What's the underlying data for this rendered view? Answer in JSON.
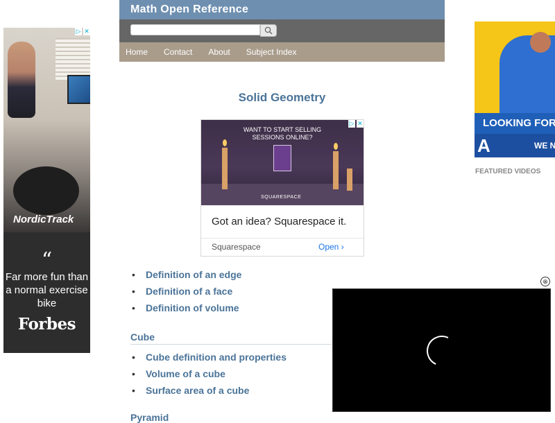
{
  "header": {
    "site_title": "Math Open Reference",
    "search_placeholder": "",
    "search_icon": "search-icon",
    "nav": [
      "Home",
      "Contact",
      "About",
      "Subject Index"
    ]
  },
  "main": {
    "title": "Solid Geometry",
    "general_links": [
      "Definition of an edge",
      "Definition of a face",
      "Definition of volume"
    ],
    "cube_heading": "Cube",
    "cube_links": [
      "Cube definition and properties",
      "Volume of a cube",
      "Surface area of a cube"
    ],
    "next_heading": "Pyramid"
  },
  "ads": {
    "left": {
      "brand": "NordicTrack",
      "quote_mark": "“",
      "text": "Far more fun than a normal exercise bike",
      "source": "Forbes"
    },
    "middle": {
      "headline": "WANT TO START SELLING SESSIONS ONLINE?",
      "image_brand": "SQUARESPACE",
      "tagline": "Got an idea? Squarespace it.",
      "advertiser": "Squarespace",
      "cta": "Open"
    },
    "right": {
      "banner": "LOOKING FOR",
      "logo_letter": "A",
      "logo_text": "WE N"
    },
    "ad_choices_icons": [
      "ad-choices-icon",
      "close-icon"
    ]
  },
  "featured_videos_label": "FEATURED VIDEOS",
  "video_player": {
    "close_symbol": "⊗",
    "state": "loading"
  },
  "colors": {
    "title_bar": "#6e8fb0",
    "search_bar": "#666666",
    "nav_bar": "#a99c8b",
    "link": "#4a7398"
  }
}
